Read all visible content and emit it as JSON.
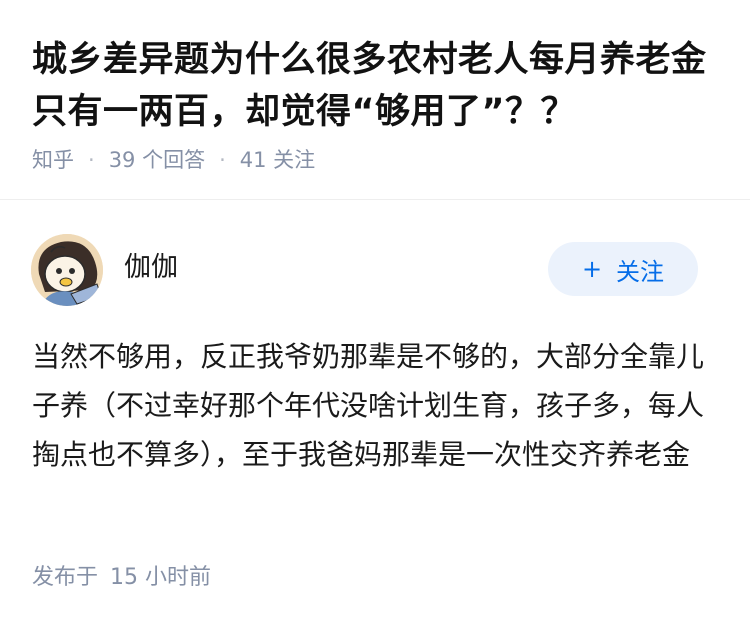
{
  "question": {
    "title": "城乡差异题为什么很多农村老人每月养老金只有一两百，却觉得“够用了”？？",
    "source": "知乎",
    "answers_count": "39 个回答",
    "followers_count": "41 关注"
  },
  "answer": {
    "author_name": "伽伽",
    "follow_button": {
      "icon": "+",
      "label": "关注"
    },
    "content": "当然不够用，反正我爷奶那辈是不够的，大部分全靠儿子养（不过幸好那个年代没啥计划生育，孩子多，每人掏点也不算多），至于我爸妈那辈是一次性交齐养老金",
    "posted_label": "发布于",
    "posted_time": "15 小时前"
  },
  "colors": {
    "meta_text": "#8590a6",
    "follow_bg": "#ebf2fc",
    "follow_text": "#056de8"
  }
}
